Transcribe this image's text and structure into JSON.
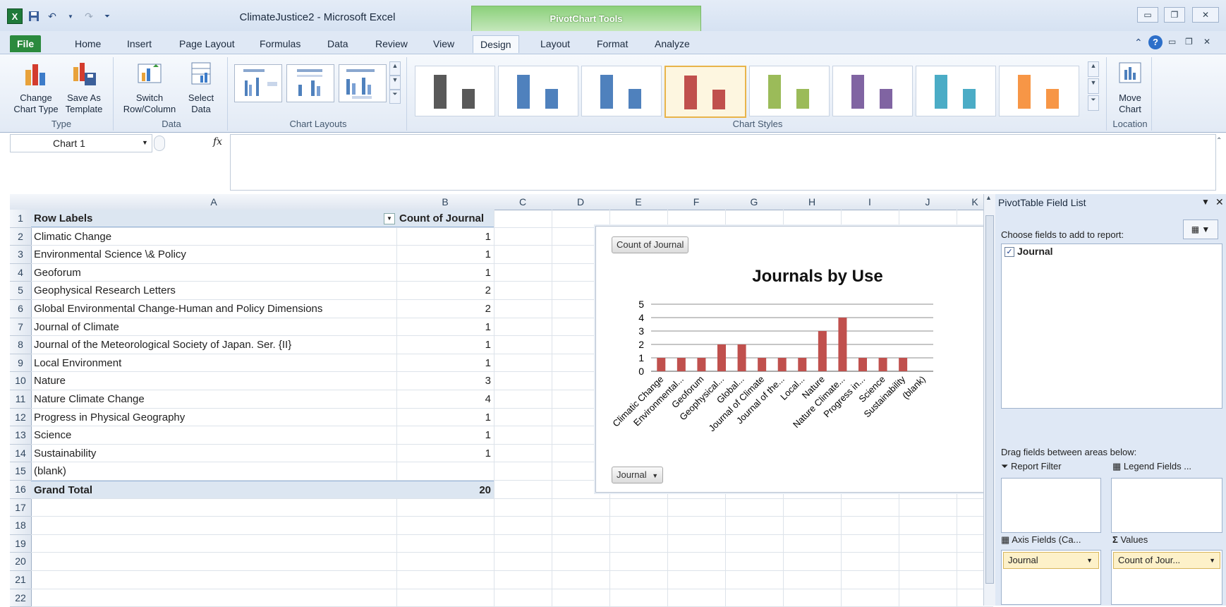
{
  "window": {
    "title": "ClimateJustice2  -  Microsoft Excel",
    "context_group": "PivotChart Tools"
  },
  "tabs": [
    "File",
    "Home",
    "Insert",
    "Page Layout",
    "Formulas",
    "Data",
    "Review",
    "View",
    "Design",
    "Layout",
    "Format",
    "Analyze"
  ],
  "ribbon": {
    "groups": {
      "type": "Type",
      "data": "Data",
      "chart_layouts": "Chart Layouts",
      "chart_styles": "Chart Styles",
      "location": "Location"
    },
    "buttons": {
      "change_chart_type": [
        "Change",
        "Chart Type"
      ],
      "save_as_template": [
        "Save As",
        "Template"
      ],
      "switch_row_column": [
        "Switch",
        "Row/Column"
      ],
      "select_data": [
        "Select",
        "Data"
      ],
      "move_chart": [
        "Move",
        "Chart"
      ]
    },
    "style_colors": [
      "#595959",
      "#4f81bd",
      "#4f81bd",
      "#c0504d",
      "#9bbb59",
      "#8064a2",
      "#4bacc6",
      "#f79646"
    ]
  },
  "formula_bar": {
    "name_box": "Chart 1",
    "fx": "fx",
    "value": ""
  },
  "columns": [
    "A",
    "B",
    "C",
    "D",
    "E",
    "F",
    "G",
    "H",
    "I",
    "J",
    "K"
  ],
  "rows": [
    "1",
    "2",
    "3",
    "4",
    "5",
    "6",
    "7",
    "8",
    "9",
    "10",
    "11",
    "12",
    "13",
    "14",
    "15",
    "16",
    "17",
    "18",
    "19",
    "20",
    "21",
    "22"
  ],
  "pivot": {
    "header_label": "Row Labels",
    "header_value": "Count of Journal",
    "items": [
      {
        "label": "Climatic Change",
        "value": "1"
      },
      {
        "label": "Environmental Science \\& Policy",
        "value": "1"
      },
      {
        "label": "Geoforum",
        "value": "1"
      },
      {
        "label": "Geophysical Research Letters",
        "value": "2"
      },
      {
        "label": "Global Environmental Change-Human and Policy Dimensions",
        "value": "2"
      },
      {
        "label": "Journal of Climate",
        "value": "1"
      },
      {
        "label": "Journal of the Meteorological Society of Japan. Ser. {II}",
        "value": "1"
      },
      {
        "label": "Local Environment",
        "value": "1"
      },
      {
        "label": "Nature",
        "value": "3"
      },
      {
        "label": "Nature Climate Change",
        "value": "4"
      },
      {
        "label": "Progress in Physical Geography",
        "value": "1"
      },
      {
        "label": "Science",
        "value": "1"
      },
      {
        "label": "Sustainability",
        "value": "1"
      },
      {
        "label": "(blank)",
        "value": ""
      }
    ],
    "total_label": "Grand Total",
    "total_value": "20"
  },
  "chart_data": {
    "type": "bar",
    "title": "Journals by Use",
    "value_button": "Count of Journal",
    "axis_button": "Journal",
    "categories": [
      "Climatic Change",
      "Environmental...",
      "Geoforum",
      "Geophysical...",
      "Global...",
      "Journal of Climate",
      "Journal of the...",
      "Local...",
      "Nature",
      "Nature Climate...",
      "Progress in...",
      "Science",
      "Sustainability",
      "(blank)"
    ],
    "values": [
      1,
      1,
      1,
      2,
      2,
      1,
      1,
      1,
      3,
      4,
      1,
      1,
      1,
      0
    ],
    "ylim": [
      0,
      5
    ],
    "yticks": [
      "0",
      "1",
      "2",
      "3",
      "4",
      "5"
    ],
    "grid": true,
    "bar_color": "#c0504d"
  },
  "field_list": {
    "title": "PivotTable Field List",
    "choose": "Choose fields to add to report:",
    "fields": [
      {
        "name": "Journal",
        "checked": true
      }
    ],
    "drag_hint": "Drag fields between areas below:",
    "report_filter": "Report Filter",
    "legend_fields": "Legend Fields ...",
    "axis_fields": "Axis Fields (Ca...",
    "values": "Values",
    "axis_item": "Journal",
    "values_item": "Count of Jour..."
  }
}
